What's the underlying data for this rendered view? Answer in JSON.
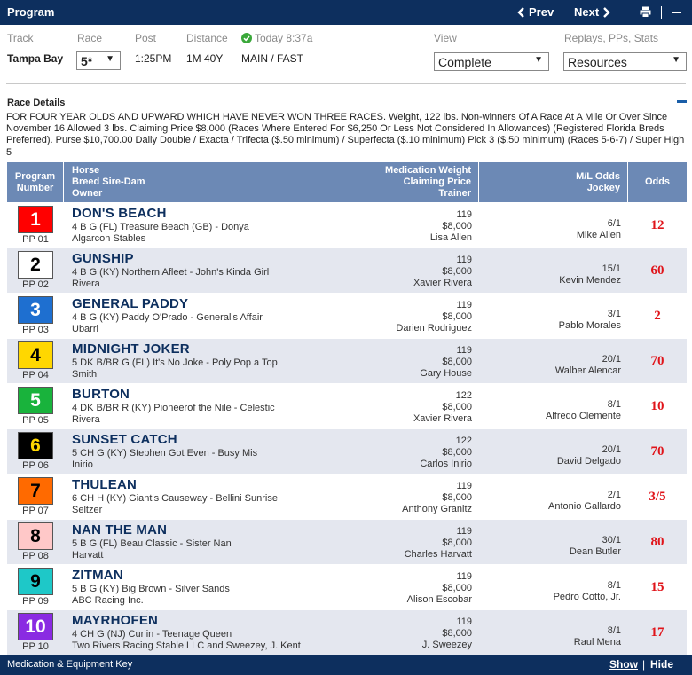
{
  "header": {
    "title": "Program",
    "prev_label": "Prev",
    "next_label": "Next"
  },
  "info": {
    "track_label": "Track",
    "track_value": "Tampa Bay",
    "race_label": "Race",
    "race_value": "5*",
    "post_label": "Post",
    "post_value": "1:25PM",
    "distance_label": "Distance",
    "distance_value": "1M 40Y",
    "status_text": "Today 8:37a",
    "surface_value": "MAIN / FAST",
    "view_label": "View",
    "view_value": "Complete",
    "replays_label": "Replays, PPs, Stats",
    "replays_value": "Resources"
  },
  "race_details": {
    "title": "Race Details",
    "text": "FOR FOUR YEAR OLDS AND UPWARD WHICH HAVE NEVER WON THREE RACES. Weight, 122 lbs. Non-winners Of A Race At A Mile Or Over Since November 16 Allowed 3 lbs. Claiming Price $8,000 (Races Where Entered For $6,250 Or Less Not Considered In Allowances) (Registered Florida Breds Preferred). Purse $10,700.00 Daily Double / Exacta / Trifecta ($.50 minimum) / Superfecta ($.10 minimum) Pick 3 ($.50 minimum) (Races 5-6-7) / Super High 5"
  },
  "table": {
    "col_program_1": "Program",
    "col_program_2": "Number",
    "col_horse_1": "Horse",
    "col_horse_2": "Breed Sire-Dam",
    "col_horse_3": "Owner",
    "col_med_1": "Medication Weight",
    "col_med_2": "Claiming Price",
    "col_med_3": "Trainer",
    "col_ml_1": "M/L Odds",
    "col_ml_2": "Jockey",
    "col_odds": "Odds"
  },
  "entries": [
    {
      "num": "1",
      "pp": "PP 01",
      "bg": "#ff0000",
      "fg": "#ffffff",
      "horse": "DON'S BEACH",
      "breed": "4 B G (FL) Treasure Beach (GB) - Donya",
      "owner": "Algarcon Stables",
      "weight": "119",
      "claim": "$8,000",
      "trainer": "Lisa Allen",
      "ml": "6/1",
      "jockey": "Mike Allen",
      "odds": "12"
    },
    {
      "num": "2",
      "pp": "PP 02",
      "bg": "#ffffff",
      "fg": "#000000",
      "horse": "GUNSHIP",
      "breed": "4 B G (KY) Northern Afleet - John's Kinda Girl",
      "owner": "Rivera",
      "weight": "119",
      "claim": "$8,000",
      "trainer": "Xavier Rivera",
      "ml": "15/1",
      "jockey": "Kevin Mendez",
      "odds": "60"
    },
    {
      "num": "3",
      "pp": "PP 03",
      "bg": "#1e6fd0",
      "fg": "#ffffff",
      "horse": "GENERAL PADDY",
      "breed": "4 B G (KY) Paddy O'Prado - General's Affair",
      "owner": "Ubarri",
      "weight": "119",
      "claim": "$8,000",
      "trainer": "Darien Rodriguez",
      "ml": "3/1",
      "jockey": "Pablo Morales",
      "odds": "2"
    },
    {
      "num": "4",
      "pp": "PP 04",
      "bg": "#ffd700",
      "fg": "#000000",
      "horse": "MIDNIGHT JOKER",
      "breed": "5 DK B/BR G (FL) It's No Joke - Poly Pop a Top",
      "owner": "Smith",
      "weight": "119",
      "claim": "$8,000",
      "trainer": "Gary House",
      "ml": "20/1",
      "jockey": "Walber Alencar",
      "odds": "70"
    },
    {
      "num": "5",
      "pp": "PP 05",
      "bg": "#19b33c",
      "fg": "#ffffff",
      "horse": "BURTON",
      "breed": "4 DK B/BR R (KY) Pioneerof the Nile - Celestic",
      "owner": "Rivera",
      "weight": "122",
      "claim": "$8,000",
      "trainer": "Xavier Rivera",
      "ml": "8/1",
      "jockey": "Alfredo Clemente",
      "odds": "10"
    },
    {
      "num": "6",
      "pp": "PP 06",
      "bg": "#000000",
      "fg": "#ffd700",
      "horse": "SUNSET CATCH",
      "breed": "5 CH G (KY) Stephen Got Even - Busy Mis",
      "owner": "Inirio",
      "weight": "122",
      "claim": "$8,000",
      "trainer": "Carlos Inirio",
      "ml": "20/1",
      "jockey": "David Delgado",
      "odds": "70"
    },
    {
      "num": "7",
      "pp": "PP 07",
      "bg": "#ff6a00",
      "fg": "#000000",
      "horse": "THULEAN",
      "breed": "6 CH H (KY) Giant's Causeway - Bellini Sunrise",
      "owner": "Seltzer",
      "weight": "119",
      "claim": "$8,000",
      "trainer": "Anthony Granitz",
      "ml": "2/1",
      "jockey": "Antonio Gallardo",
      "odds": "3/5"
    },
    {
      "num": "8",
      "pp": "PP 08",
      "bg": "#ffc8c8",
      "fg": "#000000",
      "horse": "NAN THE MAN",
      "breed": "5 B G (FL) Beau Classic - Sister Nan",
      "owner": "Harvatt",
      "weight": "119",
      "claim": "$8,000",
      "trainer": "Charles Harvatt",
      "ml": "30/1",
      "jockey": "Dean Butler",
      "odds": "80"
    },
    {
      "num": "9",
      "pp": "PP 09",
      "bg": "#1ec8c8",
      "fg": "#000000",
      "horse": "ZITMAN",
      "breed": "5 B G (KY) Big Brown - Silver Sands",
      "owner": "ABC Racing Inc.",
      "weight": "119",
      "claim": "$8,000",
      "trainer": "Alison Escobar",
      "ml": "8/1",
      "jockey": "Pedro Cotto, Jr.",
      "odds": "15"
    },
    {
      "num": "10",
      "pp": "PP 10",
      "bg": "#8a2be2",
      "fg": "#ffffff",
      "horse": "MAYRHOFEN",
      "breed": "4 CH G (NJ) Curlin - Teenage Queen",
      "owner": "Two Rivers Racing Stable LLC and Sweezey, J. Kent",
      "weight": "119",
      "claim": "$8,000",
      "trainer": "J. Sweezey",
      "ml": "8/1",
      "jockey": "Raul Mena",
      "odds": "17"
    }
  ],
  "footer": {
    "title": "Medication & Equipment Key",
    "show_label": "Show",
    "separator": "|",
    "hide_label": "Hide"
  },
  "colors": {
    "nav_bg": "#0d2f5e",
    "table_header_bg": "#6c89b5",
    "odds_color": "#e0141a",
    "status_check": "#3aa83a"
  }
}
